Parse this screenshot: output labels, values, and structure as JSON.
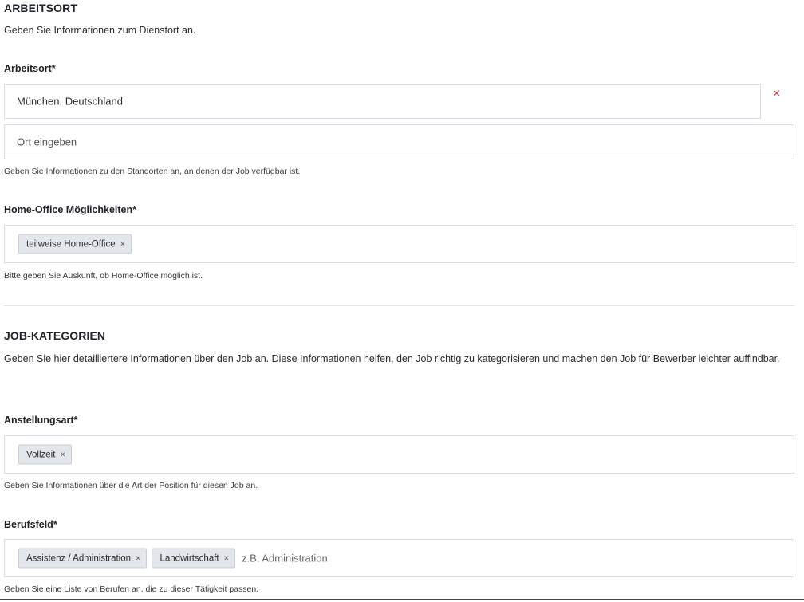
{
  "location_section": {
    "title": "ARBEITSORT",
    "description": "Geben Sie Informationen zum Dienstort an."
  },
  "workplace": {
    "label": "Arbeitsort*",
    "entries": [
      {
        "value": "München, Deutschland",
        "remove": "×"
      }
    ],
    "new_placeholder": "Ort eingeben",
    "help": "Geben Sie Informationen zu den Standorten an, an denen der Job verfügbar ist."
  },
  "home_office": {
    "label": "Home-Office Möglichkeiten*",
    "tags": [
      {
        "label": "teilweise Home-Office",
        "remove": "×"
      }
    ],
    "help": "Bitte geben Sie Auskunft, ob Home-Office möglich ist."
  },
  "category_section": {
    "title": "JOB-KATEGORIEN",
    "description": "Geben Sie hier detailliertere Informationen über den Job an. Diese Informationen helfen, den Job richtig zu kategorisieren und machen den Job für Bewerber leichter auffindbar."
  },
  "employment_type": {
    "label": "Anstellungsart*",
    "tags": [
      {
        "label": "Vollzeit",
        "remove": "×"
      }
    ],
    "help": "Geben Sie Informationen über die Art der Position für diesen Job an."
  },
  "occupational_field": {
    "label": "Berufsfeld*",
    "tags": [
      {
        "label": "Assistenz / Administration",
        "remove": "×"
      },
      {
        "label": "Landwirtschaft",
        "remove": "×"
      }
    ],
    "placeholder": "z.B. Administration",
    "help": "Geben Sie eine Liste von Berufen an, die zu dieser Tätigkeit passen."
  },
  "colors": {
    "remove_red": "#d0342c",
    "chip_bg": "#e3e6ea",
    "border": "#d9dce0"
  }
}
